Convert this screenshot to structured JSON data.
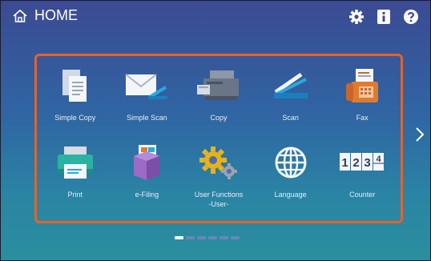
{
  "header": {
    "title": "HOME",
    "icons": [
      "gear-icon",
      "info-icon",
      "help-icon"
    ]
  },
  "tiles": [
    {
      "label": "Simple Copy",
      "icon": "simple-copy-icon"
    },
    {
      "label": "Simple Scan",
      "icon": "simple-scan-icon"
    },
    {
      "label": "Copy",
      "icon": "copy-icon"
    },
    {
      "label": "Scan",
      "icon": "scan-icon"
    },
    {
      "label": "Fax",
      "icon": "fax-icon"
    },
    {
      "label": "Print",
      "icon": "print-icon"
    },
    {
      "label": "e-Filing",
      "icon": "efiling-icon"
    },
    {
      "label": "User Functions",
      "label2": "-User-",
      "icon": "user-functions-icon"
    },
    {
      "label": "Language",
      "icon": "globe-icon"
    },
    {
      "label": "Counter",
      "icon": "counter-icon",
      "digits": [
        "1",
        "2",
        "3",
        "4"
      ]
    }
  ],
  "pager": {
    "pages": 6,
    "active": 0
  },
  "colors": {
    "accent": "#e6622a",
    "bg_top": "#3c4a93",
    "bg_bottom": "#2a8f9e"
  }
}
